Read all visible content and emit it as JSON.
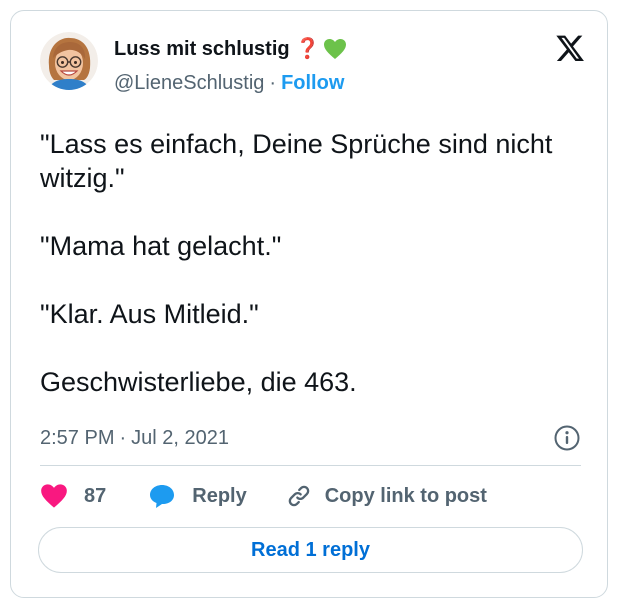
{
  "author": {
    "display_name": "Luss mit schlustig ❓",
    "handle": "@LieneSchlustig",
    "separator": "·",
    "follow_label": "Follow"
  },
  "tweet": {
    "paragraphs": [
      "\"Lass es einfach, Deine Sprüche sind nicht witzig.\"",
      "\"Mama hat gelacht.\"",
      "\"Klar. Aus Mitleid.\"",
      "Geschwisterliebe, die 463."
    ],
    "time": "2:57 PM",
    "separator": "·",
    "date": "Jul 2, 2021"
  },
  "actions": {
    "like_count": "87",
    "reply_label": "Reply",
    "copy_link_label": "Copy link to post"
  },
  "read_replies_label": "Read 1 reply",
  "icons": {
    "avatar": "avatar-memoji",
    "heart_emoji": "green-heart-icon",
    "logo": "x-logo-icon",
    "info": "info-icon",
    "like": "heart-icon",
    "reply": "speech-bubble-icon",
    "copy": "link-icon"
  },
  "colors": {
    "accent": "#1d9bf0",
    "read_reply": "#006fd6",
    "like": "#f91880",
    "heart_emoji": "#6cc24a",
    "muted": "#536471",
    "border": "#cfd9de"
  }
}
